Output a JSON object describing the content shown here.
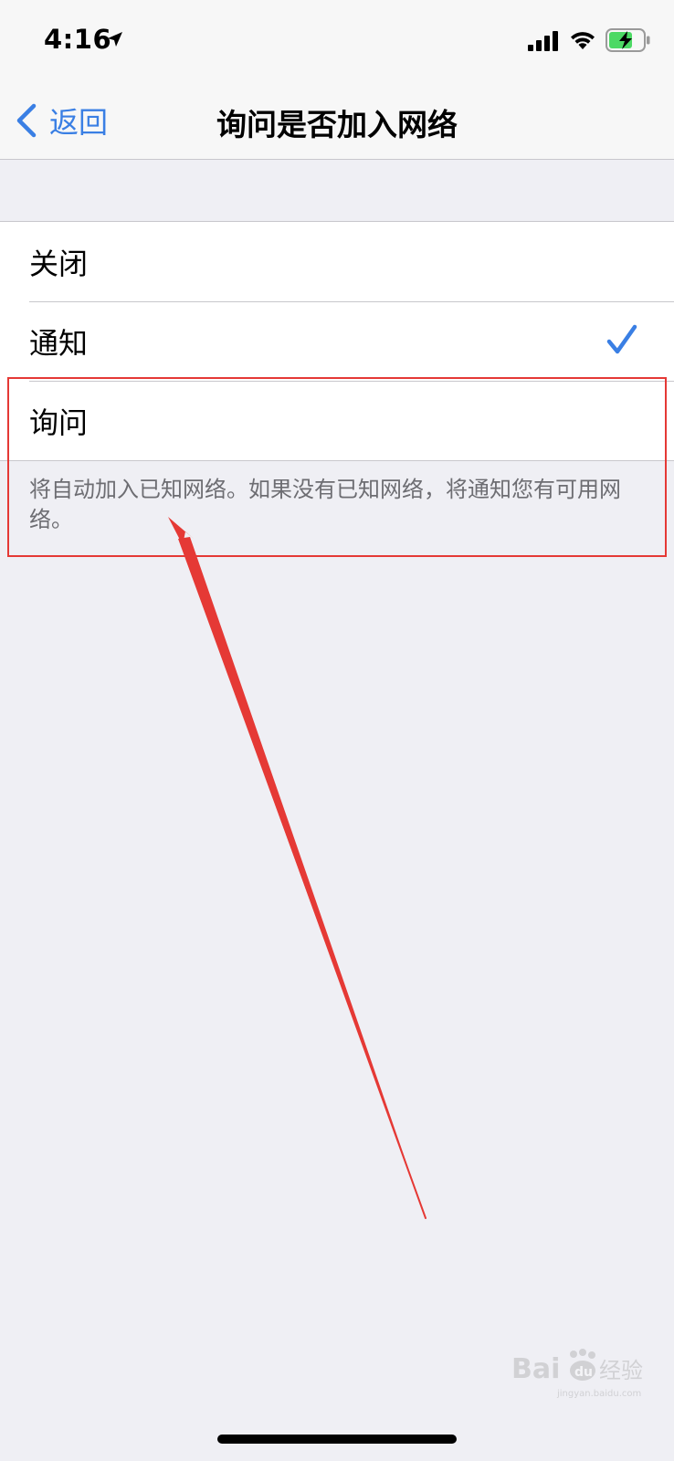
{
  "status_bar": {
    "time": "4:16"
  },
  "nav": {
    "back_label": "返回",
    "title": "询问是否加入网络"
  },
  "options": [
    {
      "label": "关闭",
      "selected": false
    },
    {
      "label": "通知",
      "selected": true
    },
    {
      "label": "询问",
      "selected": false
    }
  ],
  "footer_note": "将自动加入已知网络。如果没有已知网络，将通知您有可用网络。",
  "watermark": {
    "brand": "Bai du 经验",
    "url": "jingyan.baidu.com"
  },
  "colors": {
    "accent": "#3a7fe4",
    "annotation": "#e53935",
    "background": "#efeff4"
  }
}
